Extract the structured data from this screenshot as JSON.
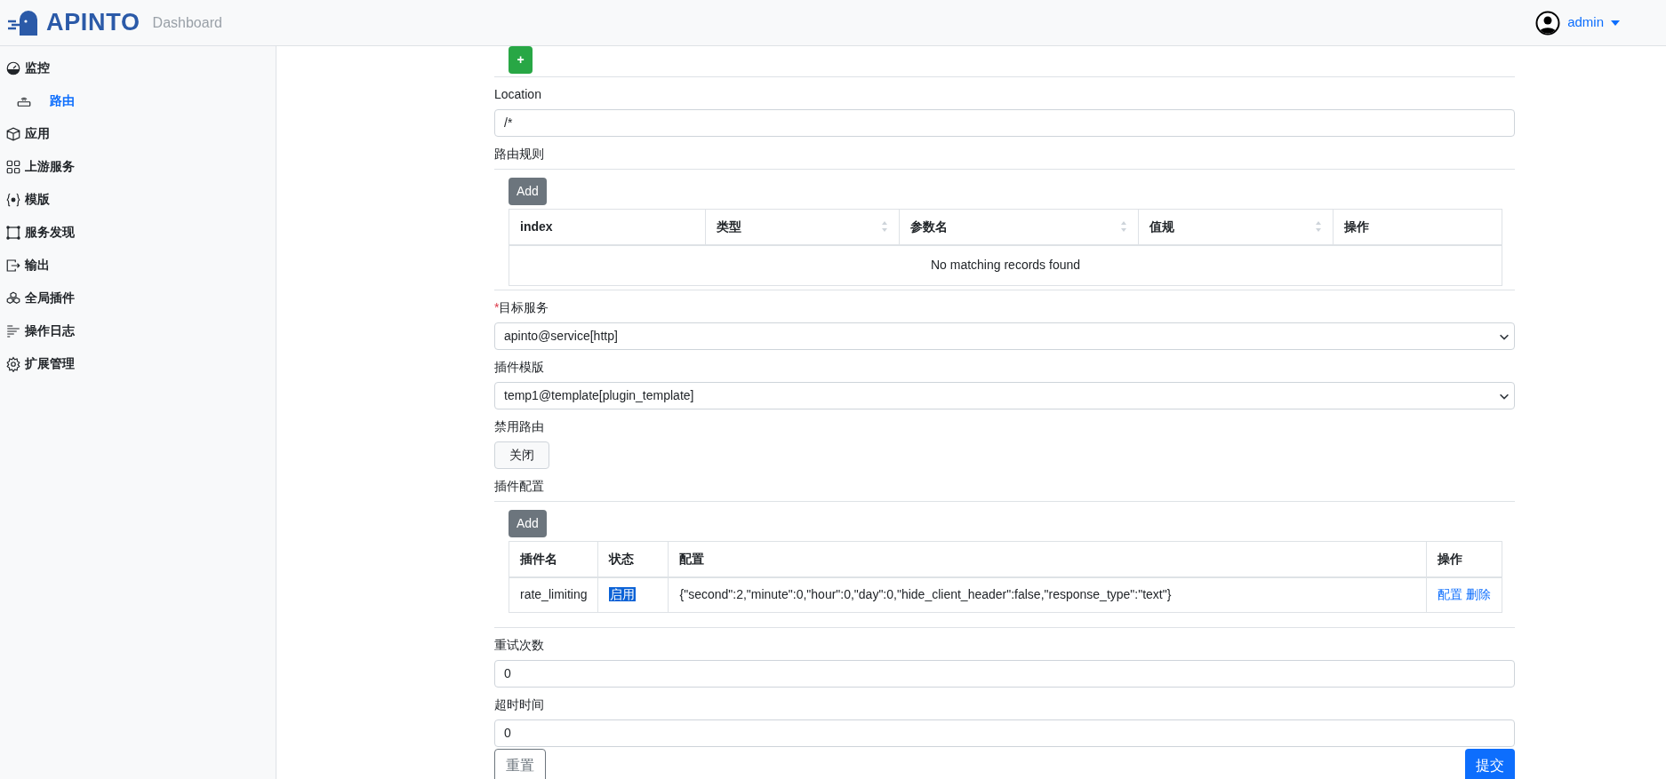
{
  "header": {
    "logo_text": "APINTO",
    "subtitle": "Dashboard",
    "user": "admin"
  },
  "sidebar": {
    "items": [
      {
        "label": "监控",
        "selected": false,
        "children": [
          {
            "label": "路由",
            "selected": true
          }
        ]
      },
      {
        "label": "应用",
        "selected": false
      },
      {
        "label": "上游服务",
        "selected": false
      },
      {
        "label": "模版",
        "selected": false
      },
      {
        "label": "服务发现",
        "selected": false
      },
      {
        "label": "输出",
        "selected": false
      },
      {
        "label": "全局插件",
        "selected": false
      },
      {
        "label": "操作日志",
        "selected": false
      },
      {
        "label": "扩展管理",
        "selected": false
      }
    ]
  },
  "form": {
    "add_button": "+",
    "location": {
      "label": "Location",
      "value": "/*"
    },
    "rules": {
      "label": "路由规则",
      "add_button": "Add",
      "columns": [
        {
          "label": "index",
          "sortable": false
        },
        {
          "label": "类型",
          "sortable": true
        },
        {
          "label": "参数名",
          "sortable": true
        },
        {
          "label": "值规",
          "sortable": true
        },
        {
          "label": "操作",
          "sortable": false
        }
      ],
      "empty_text": "No matching records found"
    },
    "target_service": {
      "label": "目标服务",
      "required_mark": "*",
      "value": "apinto@service[http]"
    },
    "plugin_template": {
      "label": "插件模版",
      "value": "temp1@template[plugin_template]"
    },
    "disable_route": {
      "label": "禁用路由",
      "on": false,
      "state_text": "关闭"
    },
    "plugins": {
      "label": "插件配置",
      "add_button": "Add",
      "columns": [
        "插件名",
        "状态",
        "配置",
        "操作"
      ],
      "rows": [
        {
          "name": "rate_limiting",
          "status": "启用",
          "highlighted": true,
          "config": "{\"second\":2,\"minute\":0,\"hour\":0,\"day\":0,\"hide_client_header\":false,\"response_type\":\"text\"}",
          "actions": [
            "配置",
            "删除"
          ]
        }
      ]
    },
    "retries": {
      "label": "重试次数",
      "value": "0"
    },
    "timeout": {
      "label": "超时时间",
      "value": "0"
    },
    "reset_button": "重置",
    "submit_button": "提交"
  }
}
